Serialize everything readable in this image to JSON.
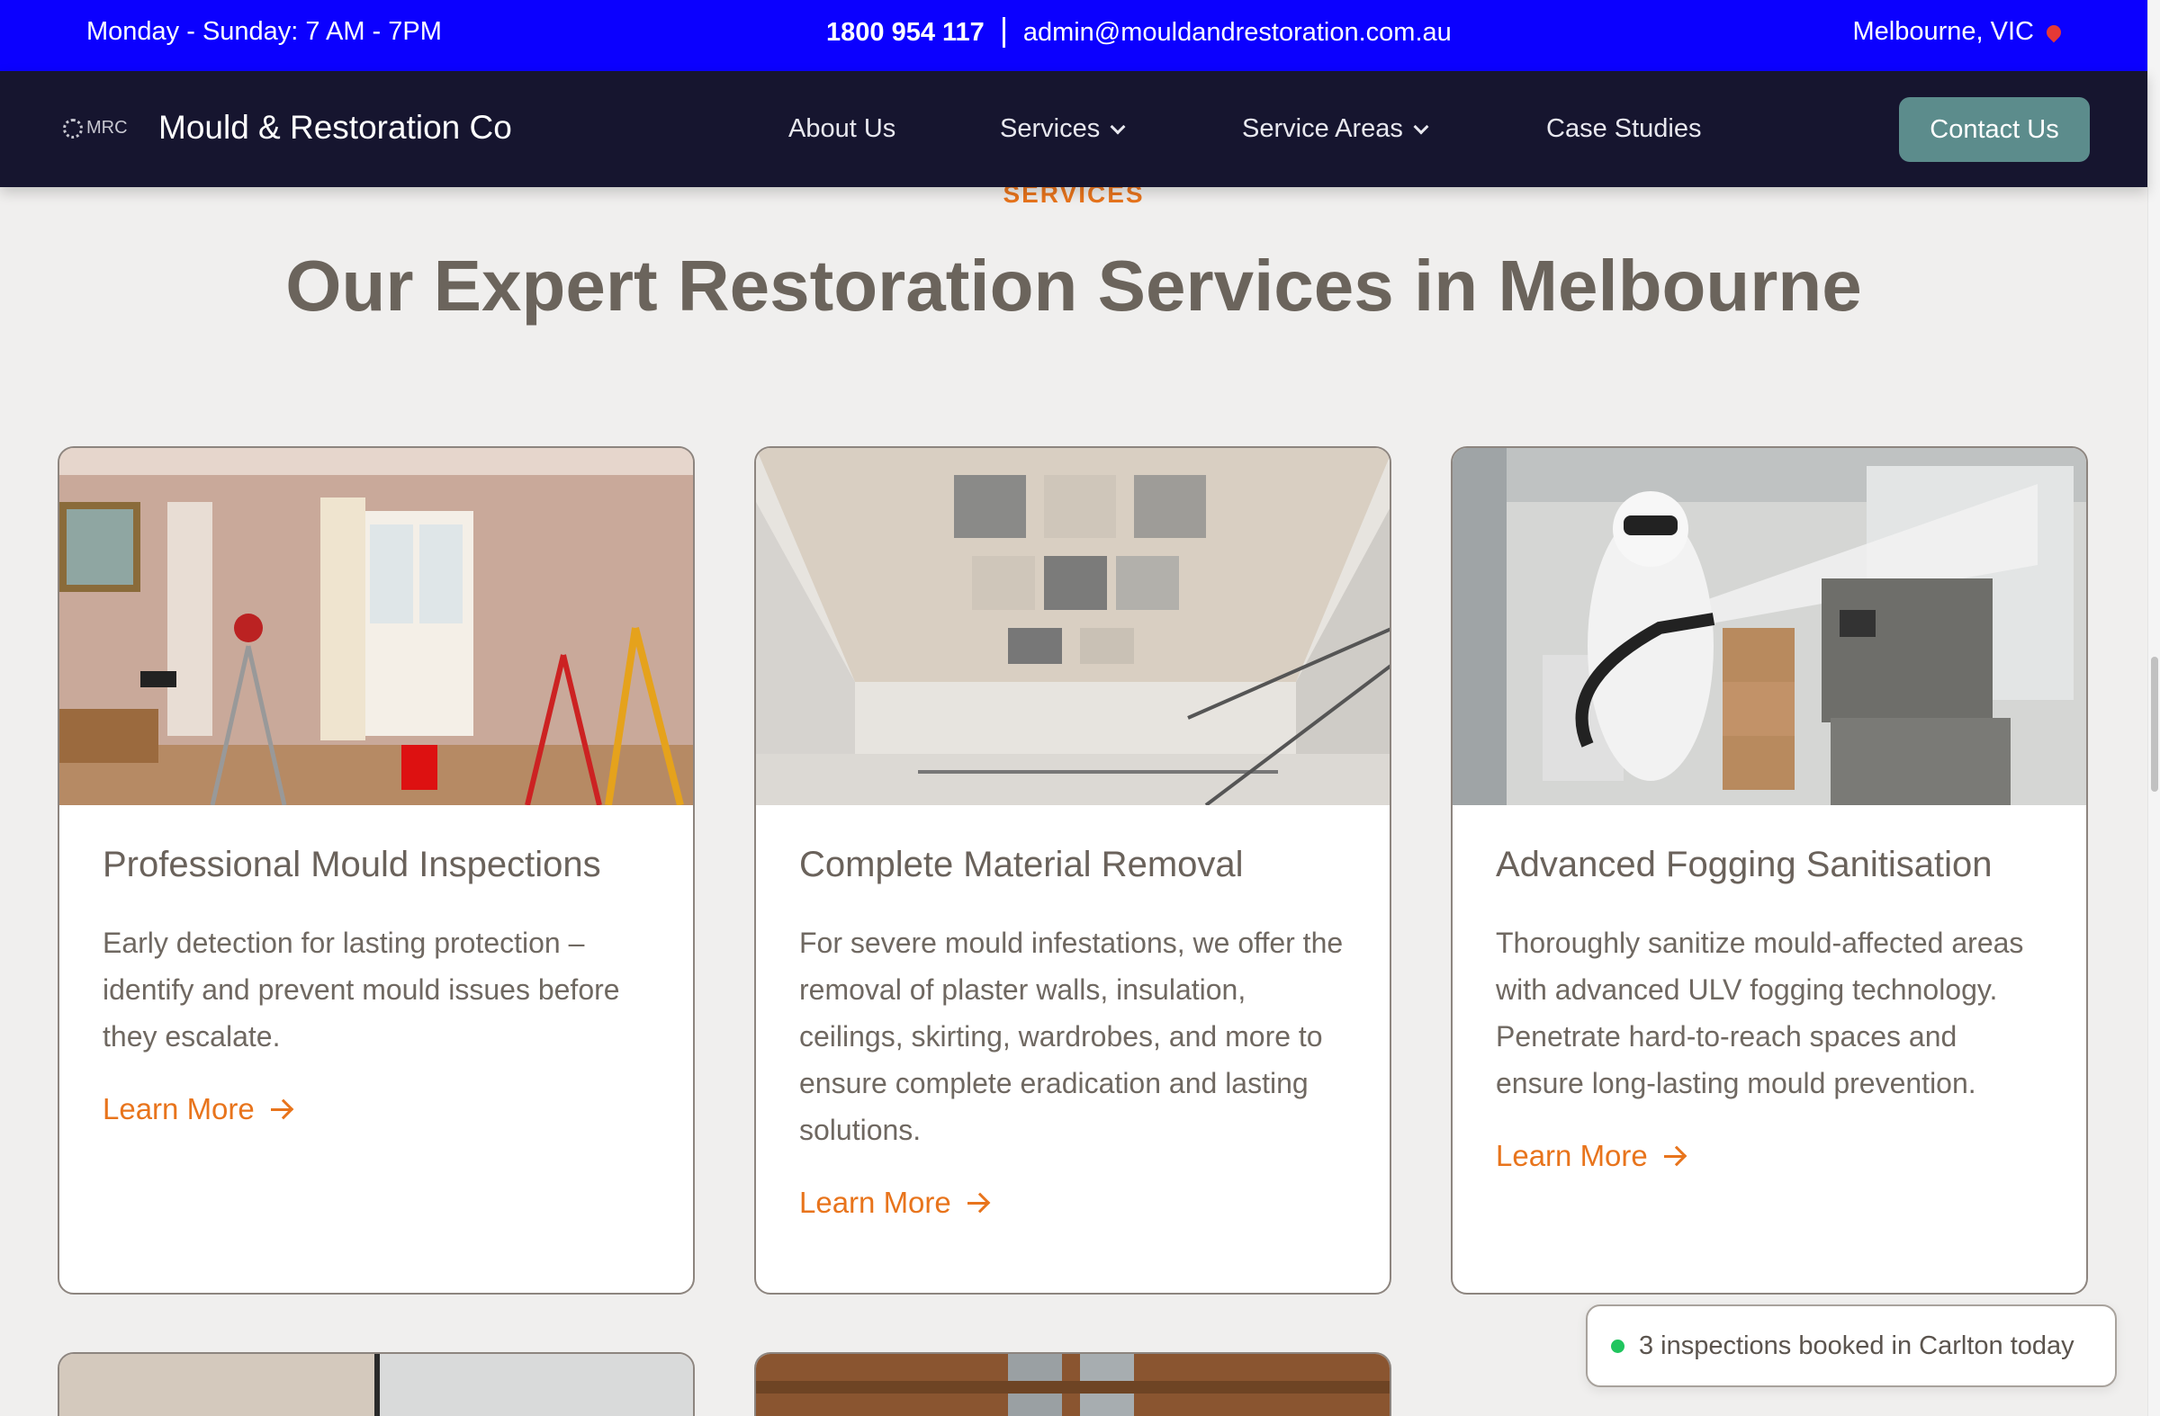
{
  "topbar": {
    "hours": "Monday - Sunday: 7 AM - 7PM",
    "phone": "1800 954 117",
    "email": "admin@mouldandrestoration.com.au",
    "location": "Melbourne, VIC"
  },
  "nav": {
    "logo_text": "MRC",
    "brand": "Mould & Restoration Co",
    "items": [
      "About Us",
      "Services",
      "Service Areas",
      "Case Studies"
    ],
    "cta": "Contact Us"
  },
  "section": {
    "eyebrow": "SERVICES",
    "title": "Our Expert Restoration Services in Melbourne"
  },
  "cards": [
    {
      "title": "Professional Mould Inspections",
      "text": "Early detection for lasting protection – identify and prevent mould issues before they escalate.",
      "link": "Learn More"
    },
    {
      "title": "Complete Material Removal",
      "text": "For severe mould infestations, we offer the removal of plaster walls, insulation, ceilings, skirting, wardrobes, and more to ensure complete eradication and lasting solutions.",
      "link": "Learn More"
    },
    {
      "title": "Advanced Fogging Sanitisation",
      "text": "Thoroughly sanitize mould-affected areas with advanced ULV fogging technology. Penetrate hard-to-reach spaces and ensure long-lasting mould prevention.",
      "link": "Learn More"
    }
  ],
  "toast": {
    "text": "3 inspections booked in Carlton today"
  },
  "colors": {
    "topbar": "#0b00ff",
    "navbar": "#16152f",
    "accent": "#e8741c",
    "cta": "#5c8c8c",
    "heading": "#6b645c"
  }
}
